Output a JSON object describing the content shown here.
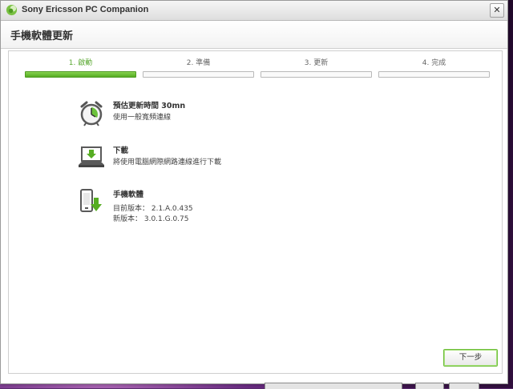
{
  "window": {
    "title": "Sony Ericsson PC Companion",
    "close_label": "✕"
  },
  "page": {
    "title": "手機軟體更新"
  },
  "steps": [
    {
      "label": "1. 啟動",
      "active": true
    },
    {
      "label": "2. 準備",
      "active": false
    },
    {
      "label": "3. 更新",
      "active": false
    },
    {
      "label": "4. 完成",
      "active": false
    }
  ],
  "info": {
    "time": {
      "title": "預估更新時間 30mn",
      "line1": "使用一般寬頻連線",
      "icon": "alarm-clock-icon"
    },
    "download": {
      "title": "下載",
      "line1": "將使用電腦網際網路連線進行下載",
      "icon": "laptop-download-icon"
    },
    "software": {
      "title": "手機軟體",
      "line1": "目前版本： 2.1.A.0.435",
      "line2": "新版本： 3.0.1.G.0.75",
      "icon": "phone-download-icon"
    }
  },
  "buttons": {
    "next_label": "下一步"
  },
  "colors": {
    "accent_green": "#56ad22",
    "step_active_text": "#5aa832"
  }
}
